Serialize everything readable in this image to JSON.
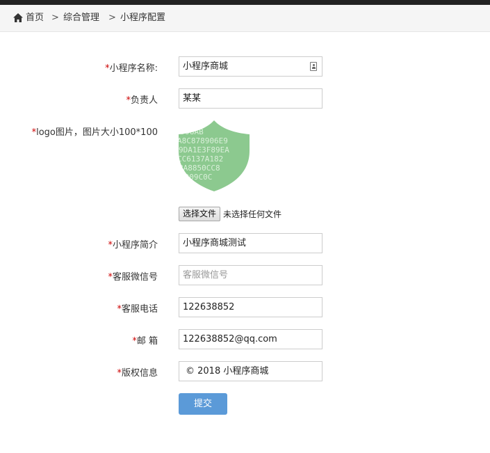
{
  "breadcrumb": {
    "home": "首页",
    "separator": ">",
    "level1": "综合管理",
    "current": "小程序配置"
  },
  "form": {
    "required_mark": "*",
    "name_label": "小程序名称:",
    "name_value": "小程序商城",
    "owner_label": "负责人",
    "owner_value": "某某",
    "logo_label": "logo图片，图片大小100*100",
    "logo_image": "shield-logo-image",
    "file_button": "选择文件",
    "file_status": "未选择任何文件",
    "intro_label": "小程序简介",
    "intro_value": "小程序商城测试",
    "wechat_label": "客服微信号",
    "wechat_placeholder": "客服微信号",
    "phone_label": "客服电话",
    "phone_value": "122638852",
    "email_label": "邮 箱",
    "email_value": "122638852@qq.com",
    "copyright_label": "版权信息",
    "copyright_value": "© 2018 小程序商城",
    "submit_label": "提交"
  },
  "colors": {
    "required": "#cc0000",
    "submit_button": "#5b9ad8",
    "topbar": "#222222",
    "logo_green": "#8cc98f"
  }
}
